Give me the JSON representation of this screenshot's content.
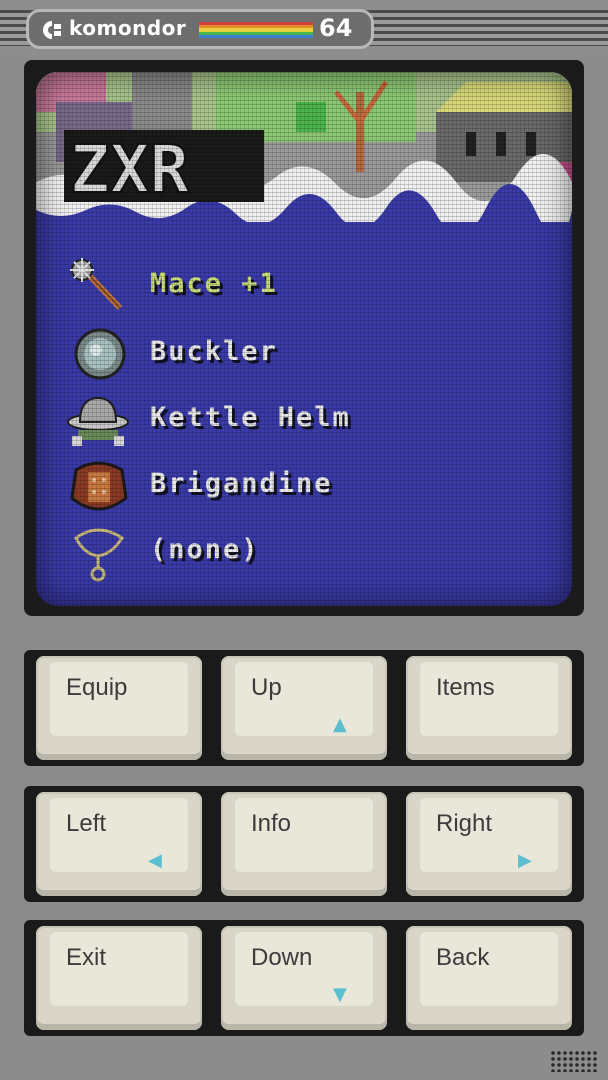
{
  "brand": {
    "name": "komondor",
    "model": "64",
    "rainbow_colors": [
      "#d23c3c",
      "#e08c2c",
      "#e6d23c",
      "#4cb44c",
      "#3c7cd2"
    ]
  },
  "game": {
    "title_logo": "ZXR",
    "colors": {
      "screen_bg": "#3a3aa8",
      "selected_text": "#c8dc78",
      "text": "#e8e8e8",
      "arrow_accent": "#5cbfd0"
    },
    "equipment": [
      {
        "label": "Mace +1",
        "icon": "mace-icon",
        "selected": true
      },
      {
        "label": "Buckler",
        "icon": "shield-icon",
        "selected": false
      },
      {
        "label": "Kettle Helm",
        "icon": "helmet-icon",
        "selected": false
      },
      {
        "label": "Brigandine",
        "icon": "armor-icon",
        "selected": false
      },
      {
        "label": "(none)",
        "icon": "amulet-icon",
        "selected": false
      }
    ]
  },
  "keypad": {
    "rows": [
      [
        {
          "label": "Equip",
          "arrow": ""
        },
        {
          "label": "Up",
          "arrow": "▲"
        },
        {
          "label": "Items",
          "arrow": ""
        }
      ],
      [
        {
          "label": "Left",
          "arrow": "◀"
        },
        {
          "label": "Info",
          "arrow": ""
        },
        {
          "label": "Right",
          "arrow": "▶"
        }
      ],
      [
        {
          "label": "Exit",
          "arrow": ""
        },
        {
          "label": "Down",
          "arrow": "▼"
        },
        {
          "label": "Back",
          "arrow": ""
        }
      ]
    ]
  }
}
